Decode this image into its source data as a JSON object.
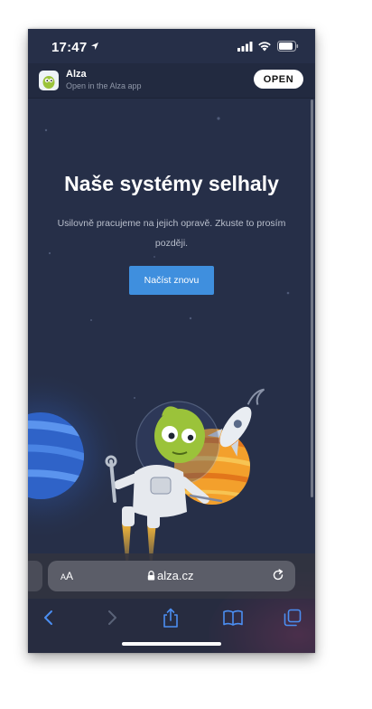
{
  "status_bar": {
    "time": "17:47"
  },
  "app_banner": {
    "app_name": "Alza",
    "subtitle": "Open in the Alza app",
    "open_label": "OPEN"
  },
  "error_page": {
    "title": "Naše systémy selhaly",
    "message_line1": "Usilovně pracujeme na jejich opravě. Zkuste to prosím",
    "message_line2": "později.",
    "reload_label": "Načíst znovu"
  },
  "browser": {
    "text_size_small": "A",
    "text_size_large": "A",
    "domain": "alza.cz",
    "toolbar_icons": [
      "back-icon",
      "forward-icon",
      "share-icon",
      "bookmarks-icon",
      "tabs-icon"
    ]
  },
  "colors": {
    "background": "#262f48",
    "accent_button": "#3f8fde",
    "alien_green": "#9bc33a",
    "planet_orange": "#f3a02c",
    "planet_blue": "#3a72d8"
  }
}
